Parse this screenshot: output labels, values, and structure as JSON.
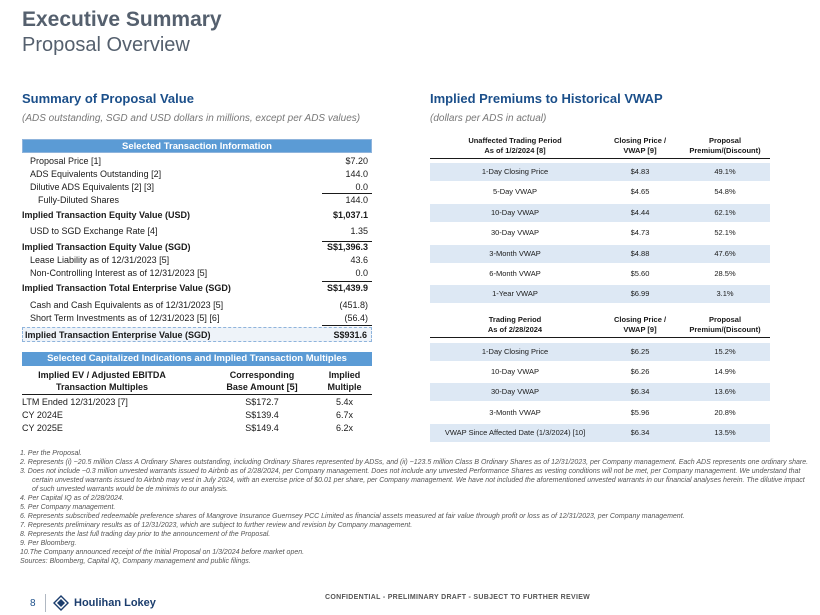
{
  "page": {
    "title": "Executive Summary",
    "subtitle": "Proposal Overview"
  },
  "left": {
    "title": "Summary of Proposal Value",
    "subtitle": "(ADS outstanding, SGD and USD dollars in millions, except per ADS values)",
    "transaction_header": "Selected Transaction Information",
    "rows": [
      {
        "label": "Proposal Price [1]",
        "value": "$7.20"
      },
      {
        "label": "ADS Equivalents Outstanding [2]",
        "value": "144.0"
      },
      {
        "label": "Dilutive ADS Equivalents [2] [3]",
        "value": "0.0"
      },
      {
        "label": "Fully-Diluted Shares",
        "value": "144.0"
      },
      {
        "label": "Implied Transaction Equity Value (USD)",
        "value": "$1,037.1"
      },
      {
        "label": "USD to SGD Exchange Rate [4]",
        "value": "1.35"
      },
      {
        "label": "Implied Transaction Equity Value (SGD)",
        "value": "S$1,396.3"
      },
      {
        "label": "Lease Liability as of 12/31/2023 [5]",
        "value": "43.6"
      },
      {
        "label": "Non-Controlling Interest as of 12/31/2023 [5]",
        "value": "0.0"
      },
      {
        "label": "Implied Transaction Total Enterprise Value (SGD)",
        "value": "S$1,439.9"
      },
      {
        "label": "Cash and Cash Equivalents as of 12/31/2023 [5]",
        "value": "(451.8)"
      },
      {
        "label": "Short Term Investments as of 12/31/2023 [5] [6]",
        "value": "(56.4)"
      },
      {
        "label": "Implied Transaction Enterprise Value (SGD)",
        "value": "S$931.6"
      }
    ],
    "multiples_header": "Selected Capitalized Indications and Implied Transaction Multiples",
    "multiples_columns": [
      "Implied EV / Adjusted EBITDA Transaction Multiples",
      "Corresponding Base Amount [5]",
      "Implied Multiple"
    ],
    "multiples_col1": [
      "Implied EV / Adjusted EBITDA",
      "Transaction Multiples"
    ],
    "multiples_col2": [
      "Corresponding",
      "Base Amount [5]"
    ],
    "multiples_col3": [
      "Implied",
      "Multiple"
    ],
    "multiples_rows": [
      {
        "period": "LTM Ended 12/31/2023 [7]",
        "base": "S$172.7",
        "multiple": "5.4x"
      },
      {
        "period": "CY 2024E",
        "base": "S$139.4",
        "multiple": "6.7x"
      },
      {
        "period": "CY 2025E",
        "base": "S$149.4",
        "multiple": "6.2x"
      }
    ]
  },
  "right": {
    "title": "Implied Premiums to Historical VWAP",
    "subtitle": "(dollars per ADS in actual)",
    "table1": {
      "h1": [
        "Unaffected Trading Period",
        "As of 1/2/2024 [8]"
      ],
      "h2": [
        "Closing Price /",
        "VWAP [9]"
      ],
      "h3": [
        "Proposal",
        "Premium/(Discount)"
      ],
      "rows": [
        {
          "period": "1-Day Closing Price",
          "price": "$4.83",
          "premium": "49.1%"
        },
        {
          "period": "5-Day VWAP",
          "price": "$4.65",
          "premium": "54.8%"
        },
        {
          "period": "10-Day VWAP",
          "price": "$4.44",
          "premium": "62.1%"
        },
        {
          "period": "30-Day VWAP",
          "price": "$4.73",
          "premium": "52.1%"
        },
        {
          "period": "3-Month VWAP",
          "price": "$4.88",
          "premium": "47.6%"
        },
        {
          "period": "6-Month VWAP",
          "price": "$5.60",
          "premium": "28.5%"
        },
        {
          "period": "1-Year VWAP",
          "price": "$6.99",
          "premium": "3.1%"
        }
      ]
    },
    "table2": {
      "h1": [
        "Trading Period",
        "As of 2/28/2024"
      ],
      "h2": [
        "Closing Price /",
        "VWAP [9]"
      ],
      "h3": [
        "Proposal",
        "Premium/(Discount)"
      ],
      "rows": [
        {
          "period": "1-Day Closing Price",
          "price": "$6.25",
          "premium": "15.2%"
        },
        {
          "period": "10-Day VWAP",
          "price": "$6.26",
          "premium": "14.9%"
        },
        {
          "period": "30-Day VWAP",
          "price": "$6.34",
          "premium": "13.6%"
        },
        {
          "period": "3-Month VWAP",
          "price": "$5.96",
          "premium": "20.8%"
        },
        {
          "period": "VWAP Since Affected Date (1/3/2024) [10]",
          "price": "$6.34",
          "premium": "13.5%"
        }
      ]
    }
  },
  "footnotes": [
    "1.  Per the Proposal.",
    "2.  Represents (i) ~20.5 million Class A Ordinary Shares outstanding, including Ordinary Shares represented by ADSs, and (ii) ~123.5 million Class B Ordinary Shares as of 12/31/2023, per Company management. Each ADS represents one ordinary share.",
    "3.  Does not include ~0.3 million unvested warrants issued to Airbnb as of 2/28/2024, per Company management. Does not include any unvested Performance Shares as vesting conditions will not be met, per Company management. We understand that certain unvested warrants issued to Airbnb may vest in July 2024, with an exercise price of $0.01 per share, per Company management. We have not included the aforementioned unvested warrants in our financial analyses herein. The dilutive impact of such unvested warrants would be de minimis to our analysis.",
    "4.  Per Capital IQ as of 2/28/2024.",
    "5.  Per Company management.",
    "6.  Represents subscribed redeemable preference shares of Mangrove Insurance Guernsey PCC Limited as financial assets measured at fair value through profit or loss as of 12/31/2023, per Company management.",
    "7.  Represents preliminary results as of 12/31/2023, which are subject to further review and revision by Company management.",
    "8.  Represents the last full trading day prior to the announcement of the Proposal.",
    "9.  Per Bloomberg.",
    "10.The Company announced receipt of the Initial Proposal on 1/3/2024 before market open.",
    "Sources: Bloomberg, Capital IQ, Company management and public filings."
  ],
  "footer": {
    "page_number": "8",
    "logo": "Houlihan Lokey",
    "confidential": "CONFIDENTIAL - PRELIMINARY DRAFT - SUBJECT TO FURTHER REVIEW"
  },
  "colors": {
    "accent_blue": "#5b9bd5",
    "title_blue": "#1b4f8a",
    "row_shade": "#dde8f4",
    "title_gray": "#55606e"
  }
}
